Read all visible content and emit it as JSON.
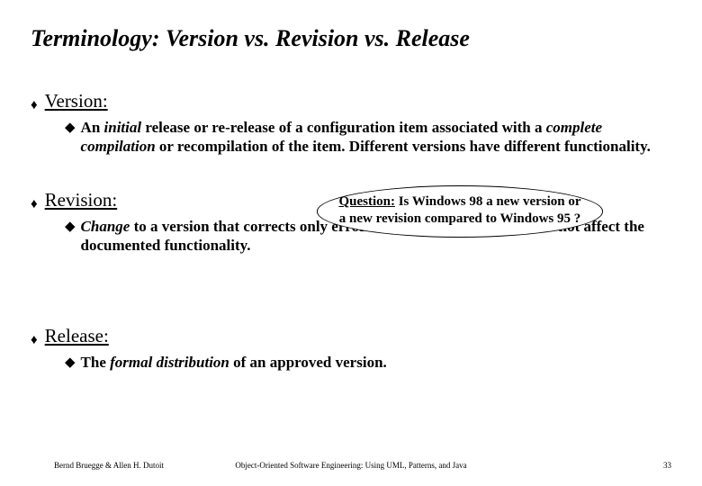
{
  "title": "Terminology: Version vs. Revision vs. Release",
  "sections": {
    "version": {
      "head": "Version:",
      "body_html": "An <em>initial</em> release or re-release of a configuration item associated with a <em>complete compilation</em> or recompilation of the item. Different versions have different functionality."
    },
    "revision": {
      "head": "Revision:",
      "body_html": "<em>Change</em> to a version that corrects only errors in the design/code, but does not affect the documented functionality."
    },
    "release": {
      "head": "Release:",
      "body_html": "The <em>formal distribution</em> of an approved version."
    }
  },
  "callout": {
    "label": "Question:",
    "text": " Is Windows 98 a new version or a new revision compared to Windows 95 ?"
  },
  "footer": {
    "left": "Bernd Bruegge & Allen H. Dutoit",
    "center": "Object-Oriented Software Engineering: Using UML, Patterns, and Java",
    "page": "33"
  }
}
